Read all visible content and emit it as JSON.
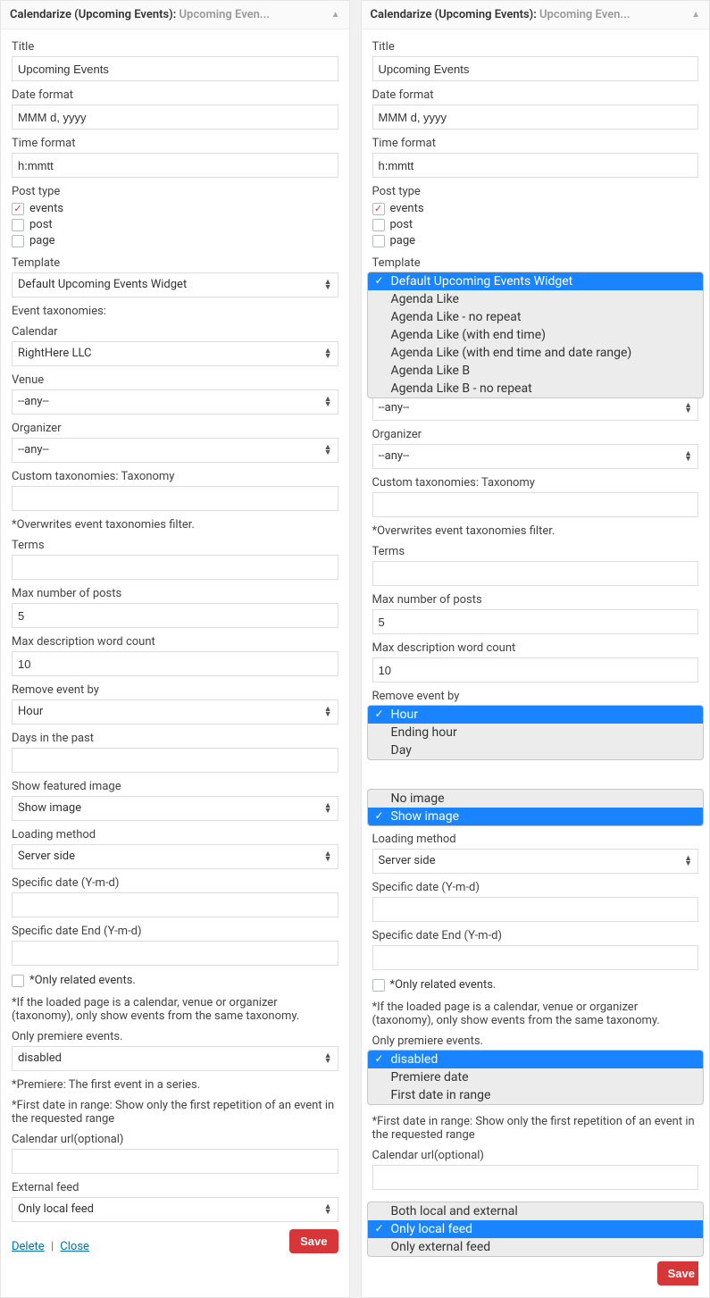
{
  "header": {
    "prefix": "Calendarize (Upcoming Events):",
    "suffix": "Upcoming Even..."
  },
  "left": {
    "title": {
      "label": "Title",
      "value": "Upcoming Events"
    },
    "date_format": {
      "label": "Date format",
      "value": "MMM d, yyyy"
    },
    "time_format": {
      "label": "Time format",
      "value": "h:mmtt"
    },
    "post_type": {
      "label": "Post type",
      "options": [
        {
          "label": "events",
          "checked": true
        },
        {
          "label": "post",
          "checked": false
        },
        {
          "label": "page",
          "checked": false
        }
      ]
    },
    "template": {
      "label": "Template",
      "value": "Default Upcoming Events Widget"
    },
    "event_tax_heading": "Event taxonomies:",
    "calendar": {
      "label": "Calendar",
      "value": "RightHere LLC"
    },
    "venue": {
      "label": "Venue",
      "value": "--any--"
    },
    "organizer": {
      "label": "Organizer",
      "value": "--any--"
    },
    "custom_tax_heading_prefix": "Custom taxonomies:",
    "custom_tax_heading_value": "Taxonomy",
    "custom_tax_value": "",
    "overwrites_note": "*Overwrites event taxonomies filter.",
    "terms": {
      "label": "Terms",
      "value": ""
    },
    "max_posts": {
      "label": "Max number of posts",
      "value": "5"
    },
    "max_desc": {
      "label": "Max description word count",
      "value": "10"
    },
    "remove_by": {
      "label": "Remove event by",
      "value": "Hour"
    },
    "days_past": {
      "label": "Days in the past",
      "value": ""
    },
    "show_featured": {
      "label": "Show featured image",
      "value": "Show image"
    },
    "loading": {
      "label": "Loading method",
      "value": "Server side"
    },
    "spec_date": {
      "label": "Specific date (Y-m-d)",
      "value": ""
    },
    "spec_date_end": {
      "label": "Specific date End (Y-m-d)",
      "value": ""
    },
    "only_related": {
      "checked": false,
      "label": "*Only related events."
    },
    "related_note": "*If the loaded page is a calendar, venue or organizer (taxonomy), only show events from the same taxonomy.",
    "only_premiere": {
      "label": "Only premiere events.",
      "value": "disabled"
    },
    "premiere_note": "*Premiere: The first event in a series.",
    "first_range_note": "*First date in range: Show only the first repetition of an event in the requested range",
    "cal_url": {
      "label": "Calendar url(optional)",
      "value": ""
    },
    "ext_feed": {
      "label": "External feed",
      "value": "Only local feed"
    },
    "delete": "Delete",
    "close": "Close",
    "save": "Save"
  },
  "right": {
    "template_options": [
      "Default Upcoming Events Widget",
      "Agenda Like",
      "Agenda Like - no repeat",
      "Agenda Like (with end time)",
      "Agenda Like (with end time and date range)",
      "Agenda Like B",
      "Agenda Like B - no repeat"
    ],
    "venue_value": "--any--",
    "remove_by_options": [
      "Hour",
      "Ending hour",
      "Day"
    ],
    "show_featured_options": [
      "No image",
      "Show image"
    ],
    "loading_value": "Server side",
    "only_premiere_options": [
      "disabled",
      "Premiere date",
      "First date in range"
    ],
    "ext_feed_options": [
      "Both local and external",
      "Only local feed",
      "Only external feed"
    ]
  }
}
